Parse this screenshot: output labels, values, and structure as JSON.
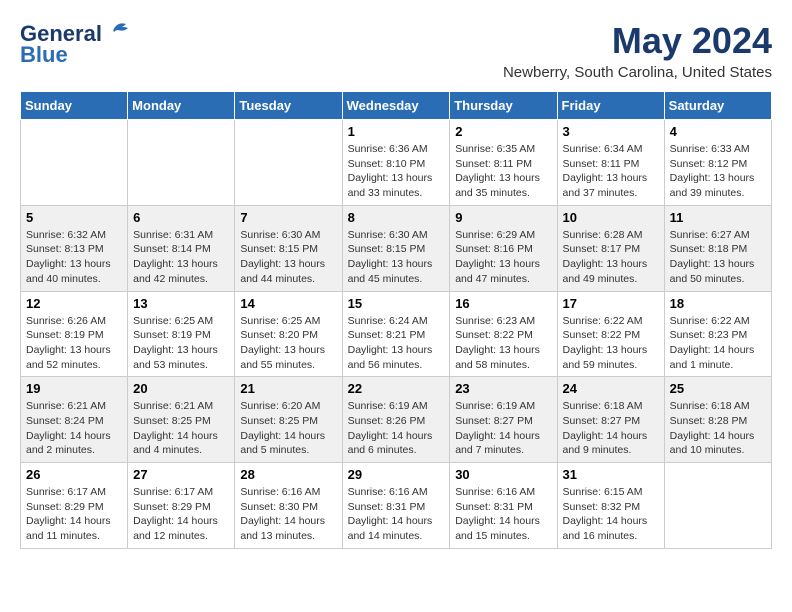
{
  "header": {
    "logo_general": "General",
    "logo_blue": "Blue",
    "month_year": "May 2024",
    "location": "Newberry, South Carolina, United States"
  },
  "weekdays": [
    "Sunday",
    "Monday",
    "Tuesday",
    "Wednesday",
    "Thursday",
    "Friday",
    "Saturday"
  ],
  "weeks": [
    [
      {
        "day": "",
        "info": ""
      },
      {
        "day": "",
        "info": ""
      },
      {
        "day": "",
        "info": ""
      },
      {
        "day": "1",
        "info": "Sunrise: 6:36 AM\nSunset: 8:10 PM\nDaylight: 13 hours\nand 33 minutes."
      },
      {
        "day": "2",
        "info": "Sunrise: 6:35 AM\nSunset: 8:11 PM\nDaylight: 13 hours\nand 35 minutes."
      },
      {
        "day": "3",
        "info": "Sunrise: 6:34 AM\nSunset: 8:11 PM\nDaylight: 13 hours\nand 37 minutes."
      },
      {
        "day": "4",
        "info": "Sunrise: 6:33 AM\nSunset: 8:12 PM\nDaylight: 13 hours\nand 39 minutes."
      }
    ],
    [
      {
        "day": "5",
        "info": "Sunrise: 6:32 AM\nSunset: 8:13 PM\nDaylight: 13 hours\nand 40 minutes."
      },
      {
        "day": "6",
        "info": "Sunrise: 6:31 AM\nSunset: 8:14 PM\nDaylight: 13 hours\nand 42 minutes."
      },
      {
        "day": "7",
        "info": "Sunrise: 6:30 AM\nSunset: 8:15 PM\nDaylight: 13 hours\nand 44 minutes."
      },
      {
        "day": "8",
        "info": "Sunrise: 6:30 AM\nSunset: 8:15 PM\nDaylight: 13 hours\nand 45 minutes."
      },
      {
        "day": "9",
        "info": "Sunrise: 6:29 AM\nSunset: 8:16 PM\nDaylight: 13 hours\nand 47 minutes."
      },
      {
        "day": "10",
        "info": "Sunrise: 6:28 AM\nSunset: 8:17 PM\nDaylight: 13 hours\nand 49 minutes."
      },
      {
        "day": "11",
        "info": "Sunrise: 6:27 AM\nSunset: 8:18 PM\nDaylight: 13 hours\nand 50 minutes."
      }
    ],
    [
      {
        "day": "12",
        "info": "Sunrise: 6:26 AM\nSunset: 8:19 PM\nDaylight: 13 hours\nand 52 minutes."
      },
      {
        "day": "13",
        "info": "Sunrise: 6:25 AM\nSunset: 8:19 PM\nDaylight: 13 hours\nand 53 minutes."
      },
      {
        "day": "14",
        "info": "Sunrise: 6:25 AM\nSunset: 8:20 PM\nDaylight: 13 hours\nand 55 minutes."
      },
      {
        "day": "15",
        "info": "Sunrise: 6:24 AM\nSunset: 8:21 PM\nDaylight: 13 hours\nand 56 minutes."
      },
      {
        "day": "16",
        "info": "Sunrise: 6:23 AM\nSunset: 8:22 PM\nDaylight: 13 hours\nand 58 minutes."
      },
      {
        "day": "17",
        "info": "Sunrise: 6:22 AM\nSunset: 8:22 PM\nDaylight: 13 hours\nand 59 minutes."
      },
      {
        "day": "18",
        "info": "Sunrise: 6:22 AM\nSunset: 8:23 PM\nDaylight: 14 hours\nand 1 minute."
      }
    ],
    [
      {
        "day": "19",
        "info": "Sunrise: 6:21 AM\nSunset: 8:24 PM\nDaylight: 14 hours\nand 2 minutes."
      },
      {
        "day": "20",
        "info": "Sunrise: 6:21 AM\nSunset: 8:25 PM\nDaylight: 14 hours\nand 4 minutes."
      },
      {
        "day": "21",
        "info": "Sunrise: 6:20 AM\nSunset: 8:25 PM\nDaylight: 14 hours\nand 5 minutes."
      },
      {
        "day": "22",
        "info": "Sunrise: 6:19 AM\nSunset: 8:26 PM\nDaylight: 14 hours\nand 6 minutes."
      },
      {
        "day": "23",
        "info": "Sunrise: 6:19 AM\nSunset: 8:27 PM\nDaylight: 14 hours\nand 7 minutes."
      },
      {
        "day": "24",
        "info": "Sunrise: 6:18 AM\nSunset: 8:27 PM\nDaylight: 14 hours\nand 9 minutes."
      },
      {
        "day": "25",
        "info": "Sunrise: 6:18 AM\nSunset: 8:28 PM\nDaylight: 14 hours\nand 10 minutes."
      }
    ],
    [
      {
        "day": "26",
        "info": "Sunrise: 6:17 AM\nSunset: 8:29 PM\nDaylight: 14 hours\nand 11 minutes."
      },
      {
        "day": "27",
        "info": "Sunrise: 6:17 AM\nSunset: 8:29 PM\nDaylight: 14 hours\nand 12 minutes."
      },
      {
        "day": "28",
        "info": "Sunrise: 6:16 AM\nSunset: 8:30 PM\nDaylight: 14 hours\nand 13 minutes."
      },
      {
        "day": "29",
        "info": "Sunrise: 6:16 AM\nSunset: 8:31 PM\nDaylight: 14 hours\nand 14 minutes."
      },
      {
        "day": "30",
        "info": "Sunrise: 6:16 AM\nSunset: 8:31 PM\nDaylight: 14 hours\nand 15 minutes."
      },
      {
        "day": "31",
        "info": "Sunrise: 6:15 AM\nSunset: 8:32 PM\nDaylight: 14 hours\nand 16 minutes."
      },
      {
        "day": "",
        "info": ""
      }
    ]
  ]
}
